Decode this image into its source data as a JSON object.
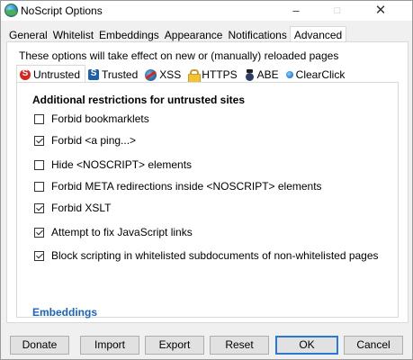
{
  "window": {
    "title": "NoScript Options",
    "controls": {
      "minimize": "–",
      "maximize": "□",
      "close": "✕"
    }
  },
  "main_tabs": [
    {
      "label": "General",
      "active": false
    },
    {
      "label": "Whitelist",
      "active": false
    },
    {
      "label": "Embeddings",
      "active": false
    },
    {
      "label": "Appearance",
      "active": false
    },
    {
      "label": "Notifications",
      "active": false
    },
    {
      "label": "Advanced",
      "active": true
    }
  ],
  "notice": "These options will take effect on new or (manually) reloaded pages",
  "sub_tabs": [
    {
      "label": "Untrusted",
      "icon": "noscript-icon",
      "active": true
    },
    {
      "label": "Trusted",
      "icon": "trusted-icon",
      "active": false
    },
    {
      "label": "XSS",
      "icon": "xss-icon",
      "active": false
    },
    {
      "label": "HTTPS",
      "icon": "https-lock-icon",
      "active": false
    },
    {
      "label": "ABE",
      "icon": "abe-icon",
      "active": false
    },
    {
      "label": "ClearClick",
      "icon": "clearclick-icon",
      "active": false
    }
  ],
  "untrusted": {
    "section_title": "Additional restrictions for untrusted sites",
    "options": [
      {
        "label": "Forbid bookmarklets",
        "checked": false
      },
      {
        "label": "Forbid <a ping...>",
        "checked": true
      },
      {
        "label": "Hide <NOSCRIPT> elements",
        "checked": false
      },
      {
        "label": "Forbid META redirections inside <NOSCRIPT> elements",
        "checked": false
      },
      {
        "label": "Forbid XSLT",
        "checked": true
      },
      {
        "label": "Attempt to fix JavaScript links",
        "checked": true
      },
      {
        "label": "Block scripting in whitelisted subdocuments of non-whitelisted pages",
        "checked": true
      }
    ],
    "embeddings_link": "Embeddings"
  },
  "buttons": {
    "donate": "Donate",
    "import": "Import",
    "export": "Export",
    "reset": "Reset",
    "ok": "OK",
    "cancel": "Cancel"
  },
  "colors": {
    "link": "#1a63c4",
    "accent_button_border": "#2a7ad4"
  }
}
